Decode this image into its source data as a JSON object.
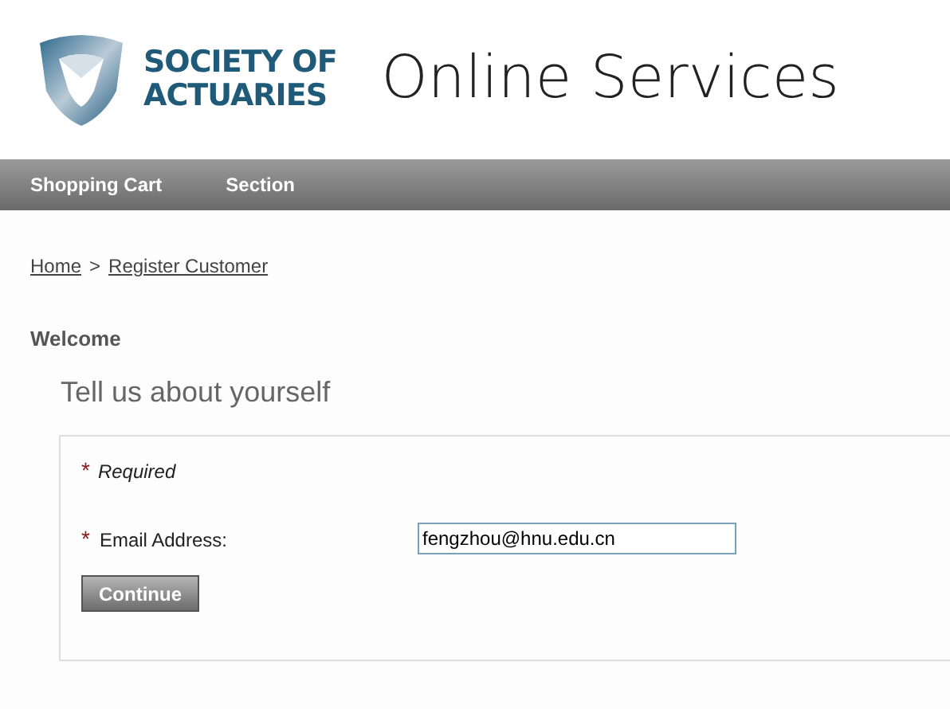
{
  "header": {
    "logo_lines": [
      "SOCIETY OF",
      "ACTUARIES"
    ],
    "title": "Online Services"
  },
  "nav": [
    {
      "label": "Shopping Cart"
    },
    {
      "label": "Section"
    }
  ],
  "breadcrumb": {
    "items": [
      {
        "label": "Home"
      },
      {
        "label": "Register Customer"
      }
    ],
    "separator": ">"
  },
  "welcome": "Welcome",
  "heading": "Tell us about yourself",
  "form": {
    "required_note": {
      "mark": "*",
      "label": "Required"
    },
    "fields": [
      {
        "mark": "*",
        "label": "Email Address:",
        "value": "fengzhou@hnu.edu.cn"
      }
    ],
    "button": "Continue"
  }
}
